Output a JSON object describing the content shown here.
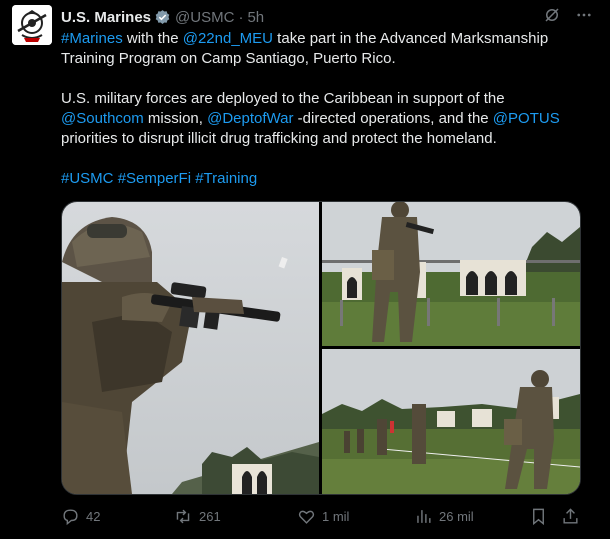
{
  "author": {
    "name": "U.S. Marines",
    "handle": "@USMC",
    "separator": "·",
    "time": "5h",
    "verified": true,
    "badge_color": "#829aab"
  },
  "tweet": {
    "p1": [
      {
        "text": "#Marines",
        "link": true
      },
      {
        "text": " with the ",
        "link": false
      },
      {
        "text": "@22nd_MEU",
        "link": true
      },
      {
        "text": " take part in the Advanced Marksmanship Training Program on Camp Santiago, Puerto Rico.",
        "link": false
      }
    ],
    "p2": [
      {
        "text": "U.S. military forces are deployed to the Caribbean in support of the ",
        "link": false
      },
      {
        "text": "@Southcom",
        "link": true
      },
      {
        "text": " mission, ",
        "link": false
      },
      {
        "text": "@DeptofWar",
        "link": true
      },
      {
        "text": " -directed operations, and the ",
        "link": false
      },
      {
        "text": "@POTUS",
        "link": true
      },
      {
        "text": " priorities to disrupt illicit drug trafficking and protect the homeland.",
        "link": false
      }
    ],
    "p3": [
      {
        "text": "#USMC",
        "link": true
      },
      {
        "text": " ",
        "link": false
      },
      {
        "text": "#SemperFi",
        "link": true
      },
      {
        "text": " ",
        "link": false
      },
      {
        "text": "#Training",
        "link": true
      }
    ]
  },
  "media": {
    "photo_1": "marine-aiming-rifle-closeup",
    "photo_2": "marine-firing-at-targets",
    "photo_3": "marines-on-firing-range"
  },
  "actions": {
    "replies": "42",
    "reposts": "261",
    "likes": "1 mil",
    "views": "26 mil"
  },
  "colors": {
    "link": "#1d9bf0",
    "muted": "#71767b",
    "text": "#e7e9ea",
    "background": "#000000"
  }
}
